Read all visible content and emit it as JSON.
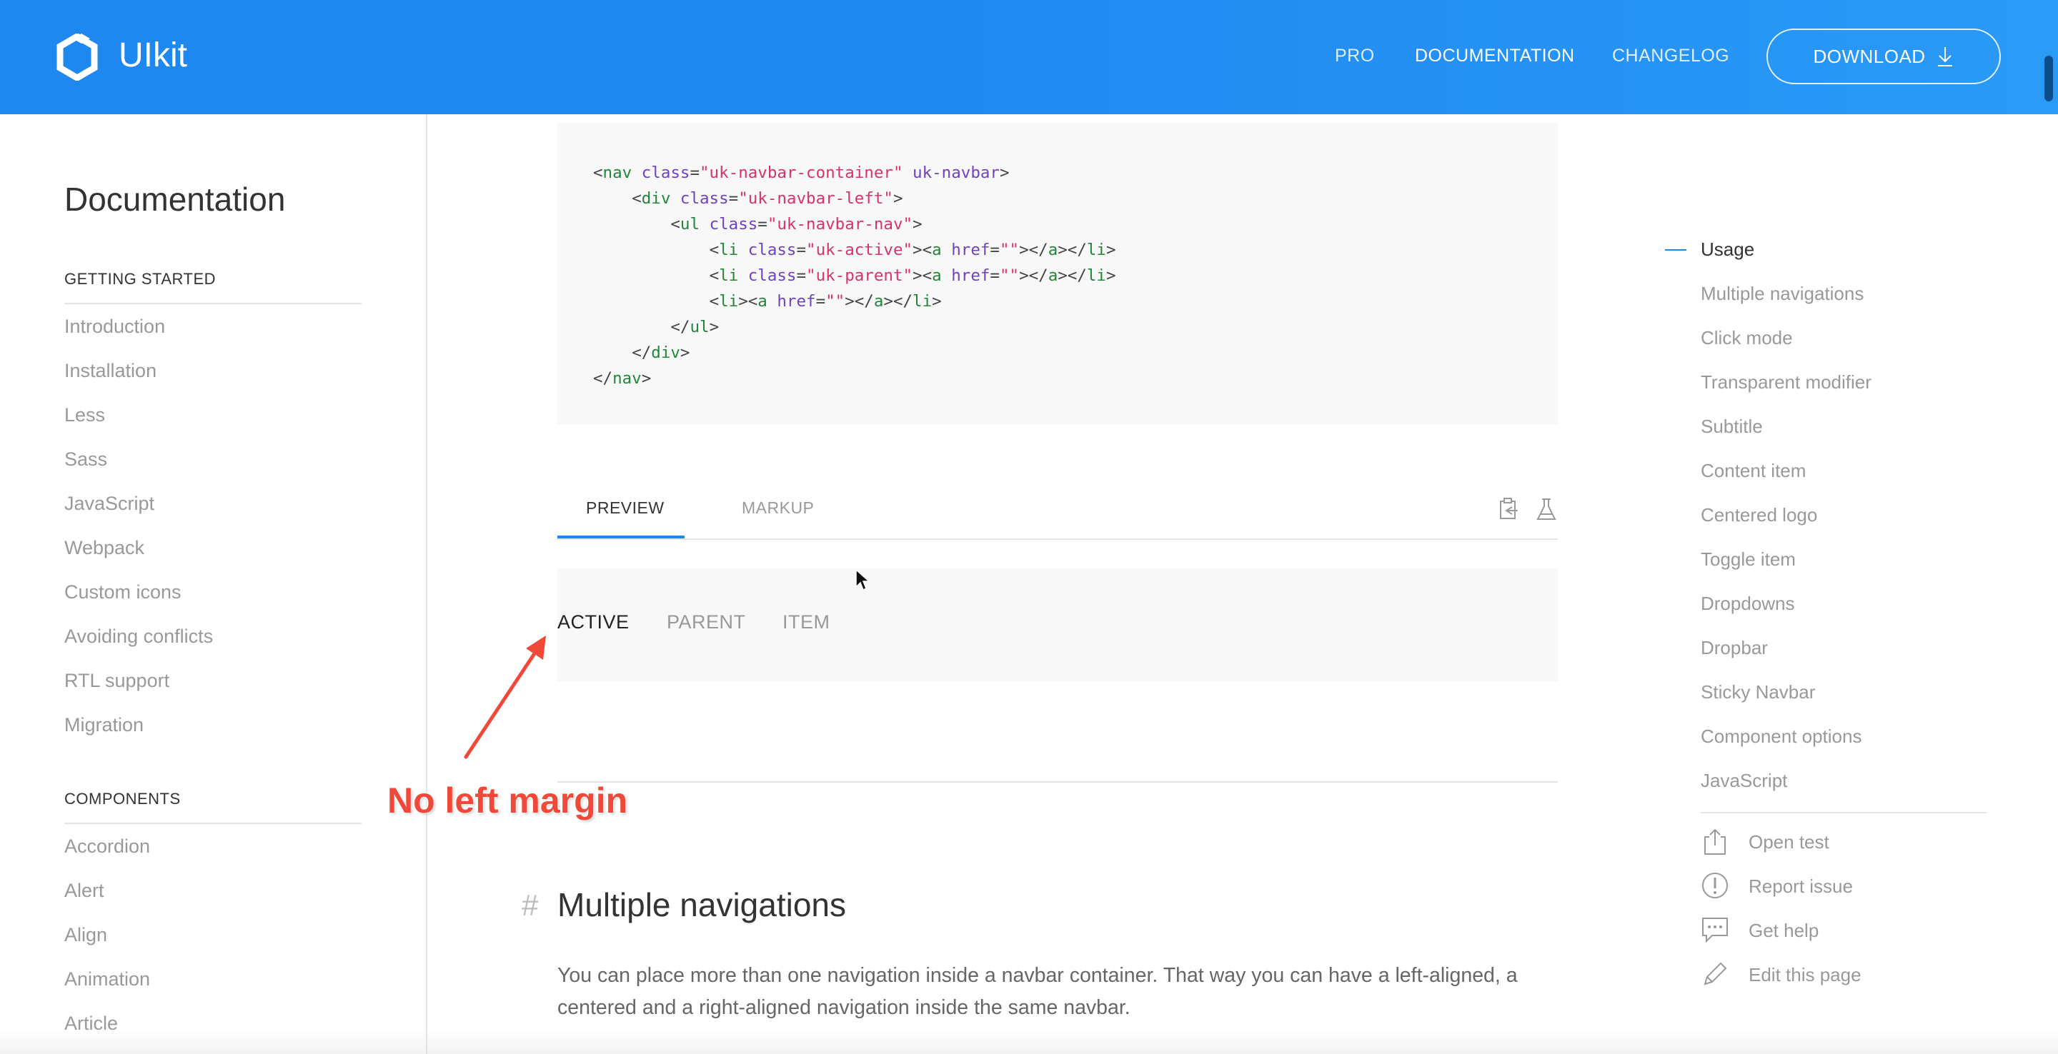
{
  "header": {
    "brand": "UIkit",
    "nav": [
      "PRO",
      "DOCUMENTATION",
      "CHANGELOG"
    ],
    "download_label": "DOWNLOAD"
  },
  "sidebar": {
    "title": "Documentation",
    "sections": [
      {
        "heading": "GETTING STARTED",
        "items": [
          "Introduction",
          "Installation",
          "Less",
          "Sass",
          "JavaScript",
          "Webpack",
          "Custom icons",
          "Avoiding conflicts",
          "RTL support",
          "Migration"
        ]
      },
      {
        "heading": "COMPONENTS",
        "items": [
          "Accordion",
          "Alert",
          "Align",
          "Animation",
          "Article"
        ]
      }
    ]
  },
  "code_lines": [
    "<nav class=\"uk-navbar-container\" uk-navbar>",
    "    <div class=\"uk-navbar-left\">",
    "        <ul class=\"uk-navbar-nav\">",
    "            <li class=\"uk-active\"><a href=\"\"></a></li>",
    "            <li class=\"uk-parent\"><a href=\"\"></a></li>",
    "            <li><a href=\"\"></a></li>",
    "        </ul>",
    "    </div>",
    "</nav>"
  ],
  "tabs": [
    "PREVIEW",
    "MARKUP"
  ],
  "preview_items": [
    "ACTIVE",
    "PARENT",
    "ITEM"
  ],
  "annotation": "No left margin",
  "section": {
    "hash": "#",
    "title": "Multiple navigations",
    "text": "You can place more than one navigation inside a navbar container. That way you can have a left-aligned, a centered and a right-aligned navigation inside the same navbar."
  },
  "toc": {
    "items": [
      "Usage",
      "Multiple navigations",
      "Click mode",
      "Transparent modifier",
      "Subtitle",
      "Content item",
      "Centered logo",
      "Toggle item",
      "Dropdowns",
      "Dropbar",
      "Sticky Navbar",
      "Component options",
      "JavaScript"
    ],
    "tools": [
      {
        "label": "Open test",
        "icon": "share-icon"
      },
      {
        "label": "Report issue",
        "icon": "warning-icon"
      },
      {
        "label": "Get help",
        "icon": "comments-icon"
      },
      {
        "label": "Edit this page",
        "icon": "pencil-icon"
      }
    ]
  },
  "colors": {
    "brand_blue": "#1e87f0",
    "annotation_red": "#f0493a"
  }
}
